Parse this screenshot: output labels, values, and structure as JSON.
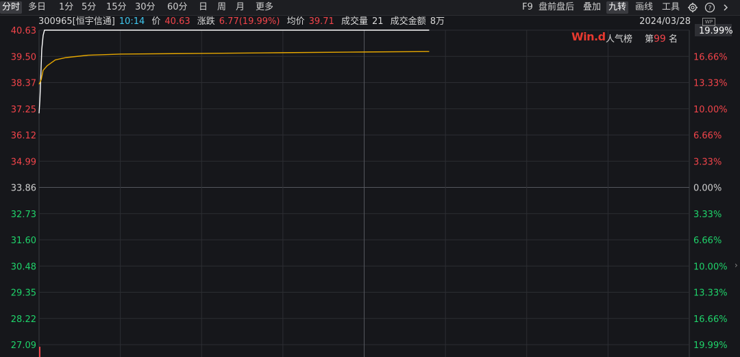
{
  "toolbar": {
    "periods": [
      {
        "label": "分时",
        "active": true
      },
      {
        "label": "多日",
        "active": false
      },
      {
        "label": "1分",
        "active": false
      },
      {
        "label": "5分",
        "active": false
      },
      {
        "label": "15分",
        "active": false
      },
      {
        "label": "30分",
        "active": false
      },
      {
        "label": "60分",
        "active": false
      },
      {
        "label": "日",
        "active": false
      },
      {
        "label": "周",
        "active": false
      },
      {
        "label": "月",
        "active": false
      },
      {
        "label": "更多",
        "active": false
      }
    ],
    "tools": [
      {
        "label": "F9",
        "active": false
      },
      {
        "label": "盘前盘后",
        "active": false
      },
      {
        "label": "叠加",
        "active": false
      },
      {
        "label": "九转",
        "active": true
      },
      {
        "label": "画线",
        "active": false
      },
      {
        "label": "工具",
        "active": false
      }
    ],
    "icons": [
      "gear-icon",
      "help-icon",
      "chevron-right-icon"
    ]
  },
  "info": {
    "code_name": "300965[恒宇信通]",
    "time": "10:14",
    "price_label": "价",
    "price": "40.63",
    "change_label": "涨跌",
    "change": "6.77(19.99%)",
    "avg_label": "均价",
    "avg": "39.71",
    "volume_label": "成交量",
    "volume": "21",
    "amount_label": "成交金额",
    "amount": "8万",
    "date": "2024/03/28"
  },
  "popularity": {
    "logo": "Win.d",
    "title": "人气榜",
    "rank_prefix": "第",
    "rank": "99",
    "rank_suffix": "名"
  },
  "chart_data": {
    "type": "line",
    "prev_close": 33.86,
    "ylim": [
      27.09,
      40.63
    ],
    "y_ticks": [
      "40.63",
      "39.50",
      "38.37",
      "37.25",
      "36.12",
      "34.99",
      "33.86",
      "32.73",
      "31.60",
      "30.48",
      "29.35",
      "28.22",
      "27.09"
    ],
    "pct_ticks": [
      "19.99%",
      "16.66%",
      "13.33%",
      "10.00%",
      "6.66%",
      "3.33%",
      "0.00%",
      "3.33%",
      "6.66%",
      "10.00%",
      "13.33%",
      "16.66%",
      "19.99%"
    ],
    "time_range_minutes": 240,
    "series": [
      {
        "label": "price",
        "color": "#ffffff",
        "points": [
          [
            0,
            37.05
          ],
          [
            0.3,
            37.6
          ],
          [
            0.6,
            38.5
          ],
          [
            1.0,
            39.8
          ],
          [
            1.5,
            40.4
          ],
          [
            2,
            40.63
          ],
          [
            4,
            40.63
          ],
          [
            60,
            40.63
          ],
          [
            120,
            40.63
          ],
          [
            144,
            40.63
          ]
        ]
      },
      {
        "label": "average",
        "color": "#e6a700",
        "points": [
          [
            0,
            38.3
          ],
          [
            0.8,
            38.5
          ],
          [
            1.5,
            38.9
          ],
          [
            3,
            39.1
          ],
          [
            6,
            39.35
          ],
          [
            10,
            39.45
          ],
          [
            18,
            39.55
          ],
          [
            30,
            39.6
          ],
          [
            60,
            39.63
          ],
          [
            90,
            39.66
          ],
          [
            120,
            39.69
          ],
          [
            144,
            39.71
          ]
        ]
      }
    ],
    "colors": {
      "up": "#f2444a",
      "down": "#1fd36a",
      "neutral": "#d0d0d0",
      "grid": "#2c2e33"
    }
  }
}
